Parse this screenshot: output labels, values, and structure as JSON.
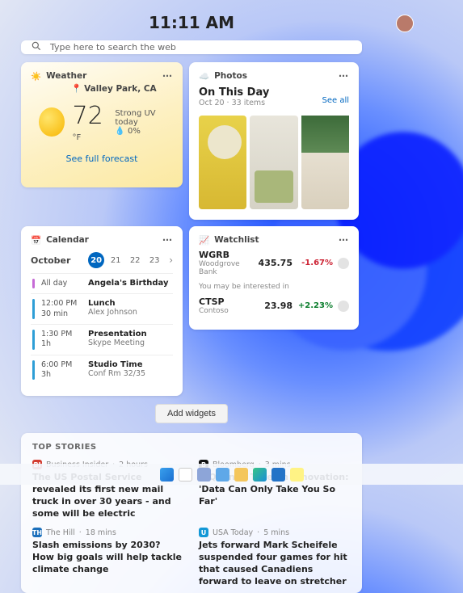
{
  "clock": "11:11 AM",
  "search": {
    "placeholder": "Type here to search the web"
  },
  "weather": {
    "label": "Weather",
    "location": "Valley Park, CA",
    "temp": "72",
    "unit": "°F",
    "cond": "Strong UV today",
    "humidity": "0%",
    "link": "See full forecast"
  },
  "photos": {
    "label": "Photos",
    "title": "On This Day",
    "sub": "Oct 20 · 33 items",
    "see_all": "See all"
  },
  "calendar": {
    "label": "Calendar",
    "month": "October",
    "days": [
      "20",
      "21",
      "22",
      "23"
    ],
    "selected": "20",
    "chev": "›",
    "items": [
      {
        "bar": "#c66bd6",
        "time": "All day",
        "dur": "",
        "title": "Angela's Birthday",
        "sub": ""
      },
      {
        "bar": "#2e9ed6",
        "time": "12:00 PM",
        "dur": "30 min",
        "title": "Lunch",
        "sub": "Alex Johnson"
      },
      {
        "bar": "#2e9ed6",
        "time": "1:30 PM",
        "dur": "1h",
        "title": "Presentation",
        "sub": "Skype Meeting"
      },
      {
        "bar": "#2e9ed6",
        "time": "6:00 PM",
        "dur": "3h",
        "title": "Studio Time",
        "sub": "Conf Rm 32/35"
      }
    ]
  },
  "watchlist": {
    "label": "Watchlist",
    "rows": [
      {
        "sym": "WGRB",
        "name": "Woodgrove Bank",
        "price": "435.75",
        "chg": "-1.67%",
        "dir": "neg"
      }
    ],
    "hint": "You may be interested in",
    "sugg": [
      {
        "sym": "CTSP",
        "name": "Contoso",
        "price": "23.98",
        "chg": "+2.23%",
        "dir": "pos"
      }
    ]
  },
  "add_widgets": "Add widgets",
  "stories": {
    "head": "TOP STORIES",
    "items": [
      {
        "ico": "#d33b2f",
        "ico_t": "BI",
        "src": "Business Insider",
        "age": "2 hours",
        "title": "The US Postal Service revealed its first new mail truck in over 30 years - and some will be electric"
      },
      {
        "ico": "#111",
        "ico_t": "B",
        "src": "Bloomberg",
        "age": "3 mins",
        "title": "A Quant's Take on Innovation: 'Data Can Only Take You So Far'"
      },
      {
        "ico": "#1b6fbb",
        "ico_t": "TH",
        "src": "The Hill",
        "age": "18 mins",
        "title": "Slash emissions by 2030? How big goals will help tackle climate change"
      },
      {
        "ico": "#1398d6",
        "ico_t": "U",
        "src": "USA Today",
        "age": "5 mins",
        "title": "Jets forward Mark Scheifele suspended four games for hit that caused Canadiens forward to leave on stretcher"
      }
    ]
  }
}
